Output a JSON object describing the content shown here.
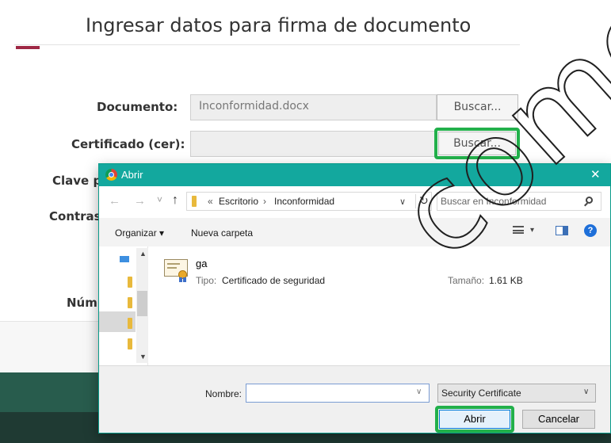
{
  "page": {
    "title": "Ingresar datos para firma de documento",
    "fields": [
      {
        "label": "Documento:",
        "value": "Inconformidad.docx",
        "button": "Buscar..."
      },
      {
        "label": "Certificado (cer):",
        "value": "",
        "button": "Buscar..."
      }
    ],
    "partial_labels": [
      "Clave p",
      "Contras",
      "Núm"
    ]
  },
  "watermark": "comer",
  "dialog": {
    "title": "Abrir",
    "close_glyph": "✕",
    "nav": {
      "back": "←",
      "forward": "→",
      "recent": "˅",
      "up": "↑"
    },
    "breadcrumb": {
      "prefix": "«",
      "parts": [
        "Escritorio",
        "Inconformidad"
      ],
      "separator": "›"
    },
    "refresh_glyph": "↻",
    "search_placeholder": "Buscar en Inconformidad",
    "toolbar": {
      "organize": "Organizar ▾",
      "new_folder": "Nueva carpeta"
    },
    "file": {
      "name": "ga",
      "type_label": "Tipo:",
      "type_value": "Certificado de seguridad",
      "size_label": "Tamaño:",
      "size_value": "1.61 KB"
    },
    "footer": {
      "name_label": "Nombre:",
      "name_value": "",
      "filter_value": "Security Certificate",
      "open_button": "Abrir",
      "cancel_button": "Cancelar"
    }
  },
  "colors": {
    "accent_green": "#22b04b",
    "dialog_title": "#13a89e",
    "title_accent": "#9e2744",
    "footer": "#285c4d"
  }
}
